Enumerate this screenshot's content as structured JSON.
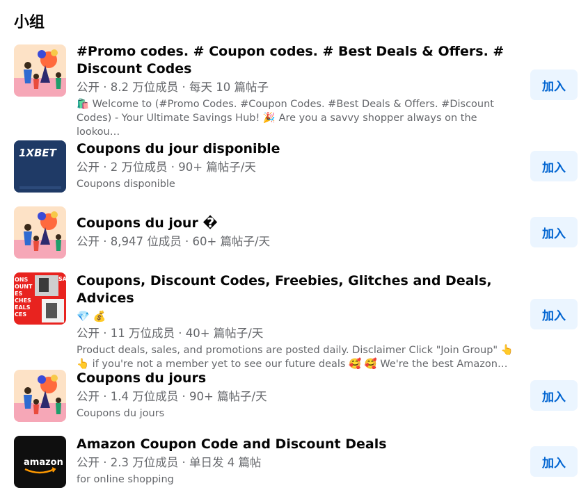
{
  "section": {
    "title": "小组"
  },
  "groups": [
    {
      "name": "#Promo codes. # Coupon codes. # Best Deals & Offers. # Discount Codes",
      "meta": "公开 · 8.2 万位成员 · 每天 10 篇帖子",
      "description": "🛍️ Welcome to (#Promo Codes. #Coupon Codes. #Best Deals & Offers. #Discount Codes) - Your Ultimate Savings Hub! 🎉 Are you a savvy shopper always on the lookou…",
      "join_label": "加入",
      "thumb_icon": "illustration-people-tree-icon"
    },
    {
      "name": "Coupons du jour disponible",
      "meta": "公开 · 2 万位成员 · 90+ 篇帖子/天",
      "description": "Coupons disponible",
      "join_label": "加入",
      "thumb_text": "1XBET"
    },
    {
      "name": "Coupons du jour �",
      "meta": "公开 · 8,947 位成员 · 60+ 篇帖子/天",
      "description": "",
      "join_label": "加入",
      "thumb_icon": "illustration-people-tree-icon"
    },
    {
      "name": "Coupons, Discount Codes, Freebies, Glitches and Deals, Advices",
      "name_emoji": "💎 💰",
      "meta": "公开 · 11 万位成员 · 40+ 篇帖子/天",
      "description_line1": "Product deals, sales, and promotions are posted daily. Disclaimer Click \"Join Group\" 👆",
      "description_line2": "👆 if you're not a member yet to see our future deals 🥰 🥰 We're the best Amazon…",
      "join_label": "加入",
      "thumb_text_lines": [
        "ONS",
        "OUNT",
        "ES",
        "CHES",
        "EALS",
        "CES"
      ],
      "thumb_text_side": "SA"
    },
    {
      "name": "Coupons du jours",
      "meta": "公开 · 1.4 万位成员 · 90+ 篇帖子/天",
      "description": "Coupons du jours",
      "join_label": "加入",
      "thumb_icon": "illustration-people-tree-icon"
    },
    {
      "name": "Amazon Coupon Code and Discount Deals",
      "meta": "公开 · 2.3 万位成员 · 单日发 4 篇帖",
      "description": "for online shopping",
      "join_label": "加入",
      "thumb_text": "amazon"
    }
  ],
  "colors": {
    "join_bg": "#ebf5ff",
    "join_text": "#0064d1",
    "meta_text": "#65676b",
    "xbet_bg": "#1f3a66",
    "amazon_bg": "#0f0f0f"
  }
}
